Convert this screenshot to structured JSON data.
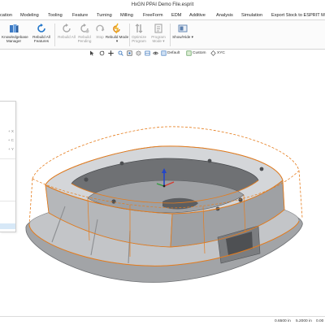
{
  "window": {
    "title": "HxGN PPAI Demo File.esprit"
  },
  "menu": {
    "items": [
      "cation",
      "Modeling",
      "Tooling",
      "Feature",
      "Turning",
      "Milling",
      "FreeForm",
      "EDM",
      "Additive",
      "Analysis",
      "Simulation",
      "Export Stock to ESPRIT Mold"
    ]
  },
  "ribbon": {
    "knowledge_manager": "Knowledgebase Manager",
    "rebuild_all": "Rebuild All Features",
    "rebuild_one": "Rebuild All",
    "rebuild_pending": "Rebuild Pending",
    "stop": "Stop",
    "rebuild_mode": "Rebuild Mode ▾",
    "optimize": "Optimize Program",
    "program_mode": "Program Mode ▾",
    "show_hide": "Show/Hide ▾"
  },
  "viewbar": {
    "default_label": "Default",
    "custom_label": "Custom",
    "xyz_label": "XYC"
  },
  "sidepanel": {
    "shortcuts": [
      "+ X",
      "+ C",
      "+ Y"
    ]
  },
  "status": {
    "coord_x": "0.6500 in",
    "coord_y": "5.2000 in",
    "coord_z": "0.00"
  },
  "colors": {
    "accent": "#1f74c9",
    "feature_orange": "#e57c1c",
    "model_gray": "#a9abae",
    "axis_x": "#d63b2f",
    "axis_y": "#2f9b3b",
    "axis_z": "#2346c8"
  }
}
